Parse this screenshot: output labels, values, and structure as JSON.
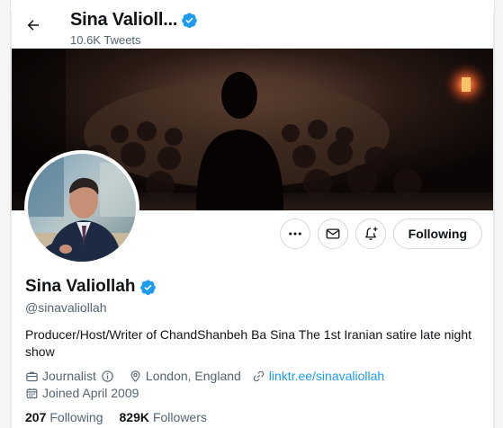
{
  "header": {
    "name": "Sina Valioll...",
    "tweets_count": "10.6K Tweets"
  },
  "profile": {
    "name": "Sina Valiollah",
    "handle": "@sinavaliollah",
    "bio": "Producer/Host/Writer of ChandShanbeh Ba Sina The 1st Iranian satire late night show",
    "category": "Journalist",
    "location": "London, England",
    "website": "linktr.ee/sinavaliollah",
    "joined": "Joined April 2009"
  },
  "actions": {
    "following_label": "Following"
  },
  "stats": {
    "following_count": "207",
    "following_label": "Following",
    "followers_count": "829K",
    "followers_label": "Followers"
  },
  "icons": {
    "back": "arrow-left-icon",
    "verified": "verified-badge-icon",
    "more": "more-dots-icon",
    "message": "envelope-icon",
    "notify": "bell-plus-icon",
    "category": "briefcase-icon",
    "info": "info-icon",
    "location": "location-pin-icon",
    "link": "link-icon",
    "calendar": "calendar-icon"
  },
  "colors": {
    "accent": "#1d9bf0",
    "text": "#0f1419",
    "secondary_text": "#536471",
    "border": "#cfd9de"
  }
}
